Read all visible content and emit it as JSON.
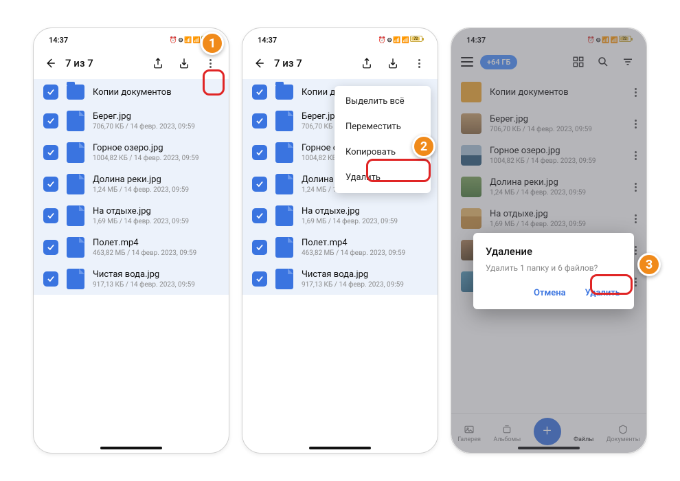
{
  "status_time": "14:37",
  "status_battery": "72",
  "selection_title": "7 из 7",
  "items": [
    {
      "name": "Копии документов",
      "sub": ""
    },
    {
      "name": "Берег.jpg",
      "sub": "706,70 КБ / 14 февр. 2023, 09:59"
    },
    {
      "name": "Горное озеро.jpg",
      "sub": "1004,82 КБ / 14 февр. 2023, 09:59"
    },
    {
      "name": "Долина реки.jpg",
      "sub": "1,24 МБ / 14 февр. 2023, 09:59"
    },
    {
      "name": "На отдыхе.jpg",
      "sub": "1,69 МБ / 14 февр. 2023, 09:59"
    },
    {
      "name": "Полет.mp4",
      "sub": "463,82 МБ / 14 февр. 2023, 09:59"
    },
    {
      "name": "Чистая вода.jpg",
      "sub": "917,13 КБ / 14 февр. 2023, 09:59"
    }
  ],
  "menu": {
    "select_all": "Выделить всё",
    "move": "Переместить",
    "copy": "Копировать",
    "delete": "Удалить"
  },
  "pill_label": "+64 ГБ",
  "dialog": {
    "title": "Удаление",
    "message": "Удалить 1 папку и 6 файлов?",
    "cancel": "Отмена",
    "confirm": "Удалить"
  },
  "nav": {
    "gallery": "Галерея",
    "albums": "Альбомы",
    "files": "Файлы",
    "docs": "Документы"
  },
  "callouts": {
    "1": "1",
    "2": "2",
    "3": "3"
  }
}
